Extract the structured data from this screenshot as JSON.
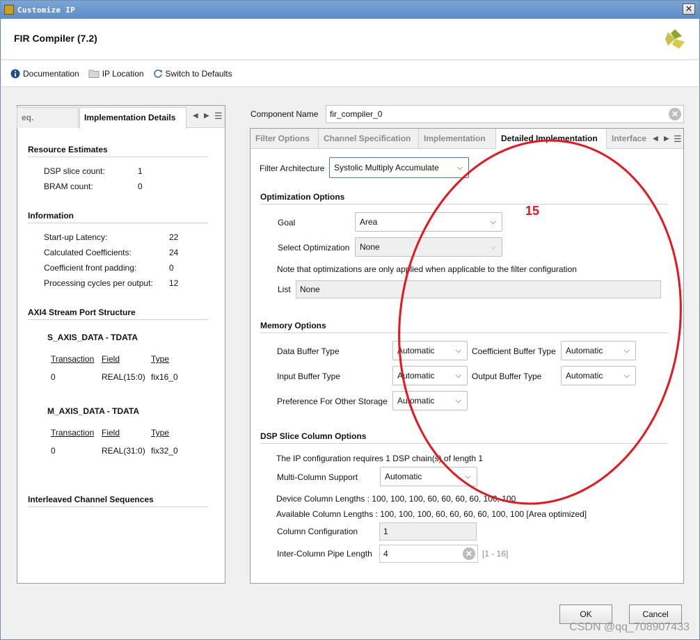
{
  "window": {
    "title": "Customize IP",
    "close": "✕"
  },
  "header": {
    "title": "FIR Compiler (7.2)"
  },
  "toolbar": {
    "documentation": "Documentation",
    "ip_location": "IP Location",
    "switch_defaults": "Switch to Defaults"
  },
  "left": {
    "tabs": [
      "eq. Response",
      "Implementation Details"
    ],
    "resource": {
      "title": "Resource Estimates",
      "dsp_label": "DSP slice count:",
      "dsp_value": "1",
      "bram_label": "BRAM count:",
      "bram_value": "0"
    },
    "info": {
      "title": "Information",
      "rows": [
        {
          "label": "Start-up Latency:",
          "value": "22"
        },
        {
          "label": "Calculated Coefficients:",
          "value": "24"
        },
        {
          "label": "Coefficient front padding:",
          "value": "0"
        },
        {
          "label": "Processing cycles per output:",
          "value": "12"
        }
      ]
    },
    "axi": {
      "title": "AXI4 Stream Port Structure",
      "s": {
        "title": "S_AXIS_DATA - TDATA",
        "h1": "Transaction",
        "h2": "Field",
        "h3": "Type",
        "c1": "0",
        "c2": "REAL(15:0)",
        "c3": "fix16_0"
      },
      "m": {
        "title": "M_AXIS_DATA - TDATA",
        "h1": "Transaction",
        "h2": "Field",
        "h3": "Type",
        "c1": "0",
        "c2": "REAL(31:0)",
        "c3": "fix32_0"
      }
    },
    "interleaved": "Interleaved Channel Sequences"
  },
  "right": {
    "component_label": "Component Name",
    "component_value": "fir_compiler_0",
    "tabs": [
      "Filter Options",
      "Channel Specification",
      "Implementation",
      "Detailed Implementation",
      "Interface"
    ],
    "filter_arch_label": "Filter Architecture",
    "filter_arch_value": "Systolic Multiply Accumulate",
    "opt": {
      "title": "Optimization Options",
      "goal_label": "Goal",
      "goal_value": "Area",
      "selopt_label": "Select Optimization",
      "selopt_value": "None",
      "note": "Note that optimizations are only applied when applicable to the filter configuration",
      "list_label": "List",
      "list_value": "None"
    },
    "mem": {
      "title": "Memory Options",
      "data_buf_label": "Data Buffer Type",
      "data_buf_value": "Automatic",
      "coef_buf_label": "Coefficient Buffer Type",
      "coef_buf_value": "Automatic",
      "in_buf_label": "Input Buffer Type",
      "in_buf_value": "Automatic",
      "out_buf_label": "Output Buffer Type",
      "out_buf_value": "Automatic",
      "pref_label": "Preference For Other Storage",
      "pref_value": "Automatic"
    },
    "dsp": {
      "title": "DSP Slice Column Options",
      "req": "The IP configuration requires 1 DSP chain(s) of length 1",
      "multi_label": "Multi-Column Support",
      "multi_value": "Automatic",
      "device_cols": "Device Column Lengths : 100, 100, 100, 60, 60, 60, 60, 100, 100",
      "avail_cols": "Available Column Lengths : 100, 100, 100, 60, 60, 60, 60, 100, 100 [Area optimized]",
      "colcfg_label": "Column Configuration",
      "colcfg_value": "1",
      "pipe_label": "Inter-Column Pipe Length",
      "pipe_value": "4",
      "pipe_range": "[1 - 16]"
    }
  },
  "annotation": {
    "number": "15",
    "color": "#e8141e"
  },
  "buttons": {
    "ok": "OK",
    "cancel": "Cancel"
  },
  "watermark": "CSDN @qq_708907433"
}
